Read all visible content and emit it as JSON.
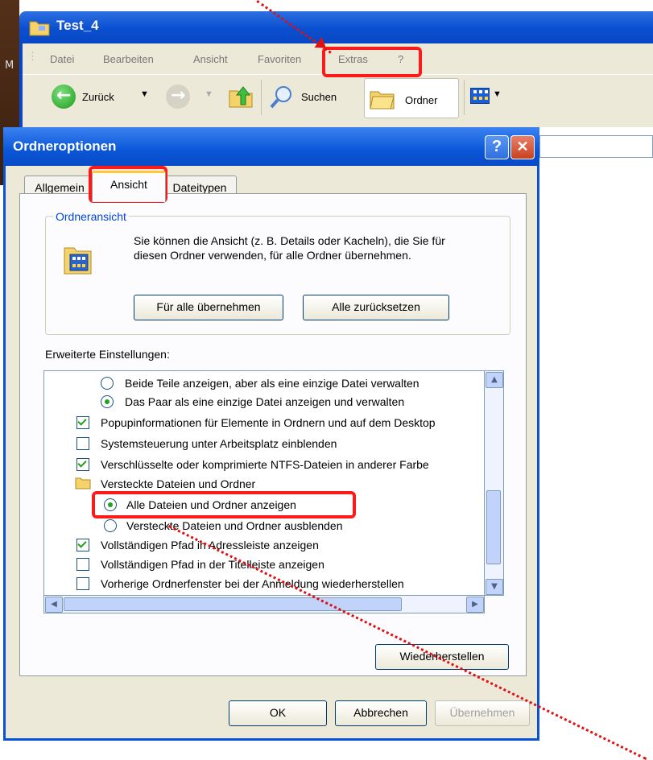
{
  "explorer": {
    "title": "Test_4",
    "menu": [
      "Datei",
      "Bearbeiten",
      "Ansicht",
      "Favoriten",
      "Extras",
      "?"
    ],
    "toolbar": {
      "back_label": "Zurück",
      "search_label": "Suchen",
      "folders_label": "Ordner"
    }
  },
  "dialog": {
    "title": "Ordneroptionen",
    "help_glyph": "?",
    "close_glyph": "✕",
    "tabs": [
      "Allgemein",
      "Ansicht",
      "Dateitypen"
    ],
    "active_tab": "Ansicht",
    "folder_view": {
      "legend": "Ordneransicht",
      "description": "Sie können die Ansicht (z. B. Details oder Kacheln), die Sie für diesen Ordner verwenden, für alle Ordner übernehmen.",
      "apply_all_label": "Für alle übernehmen",
      "reset_all_label": "Alle zurücksetzen"
    },
    "advanced": {
      "label": "Erweiterte Einstellungen:",
      "items": [
        {
          "text": "Beide Teile anzeigen, aber als eine einzige Datei verwalten",
          "kind": "radio",
          "checked": false
        },
        {
          "text": "Das Paar als eine einzige Datei anzeigen und verwalten",
          "kind": "radio",
          "checked": true
        },
        {
          "text": "Popupinformationen für Elemente in Ordnern und auf dem Desktop",
          "kind": "checkbox",
          "checked": true
        },
        {
          "text": "Systemsteuerung unter Arbeitsplatz einblenden",
          "kind": "checkbox",
          "checked": false
        },
        {
          "text": "Verschlüsselte oder komprimierte NTFS-Dateien in anderer Farbe",
          "kind": "checkbox",
          "checked": true
        },
        {
          "text": "Versteckte Dateien und Ordner",
          "kind": "folder",
          "checked": false
        },
        {
          "text": "Alle Dateien und Ordner anzeigen",
          "kind": "radio",
          "checked": true
        },
        {
          "text": "Versteckte Dateien und Ordner ausblenden",
          "kind": "radio",
          "checked": false
        },
        {
          "text": "Vollständigen Pfad in Adressleiste anzeigen",
          "kind": "checkbox",
          "checked": true
        },
        {
          "text": "Vollständigen Pfad in der Titelleiste anzeigen",
          "kind": "checkbox",
          "checked": false
        },
        {
          "text": "Vorherige Ordnerfenster bei der Anmeldung wiederherstellen",
          "kind": "checkbox",
          "checked": false
        }
      ]
    },
    "restore_label": "Wiederherstellen",
    "ok_label": "OK",
    "cancel_label": "Abbrechen",
    "apply_label": "Übernehmen"
  },
  "colors": {
    "highlight": "#ff1a1a",
    "xp_blue": "#0a56d8",
    "check_green": "#21a121"
  }
}
